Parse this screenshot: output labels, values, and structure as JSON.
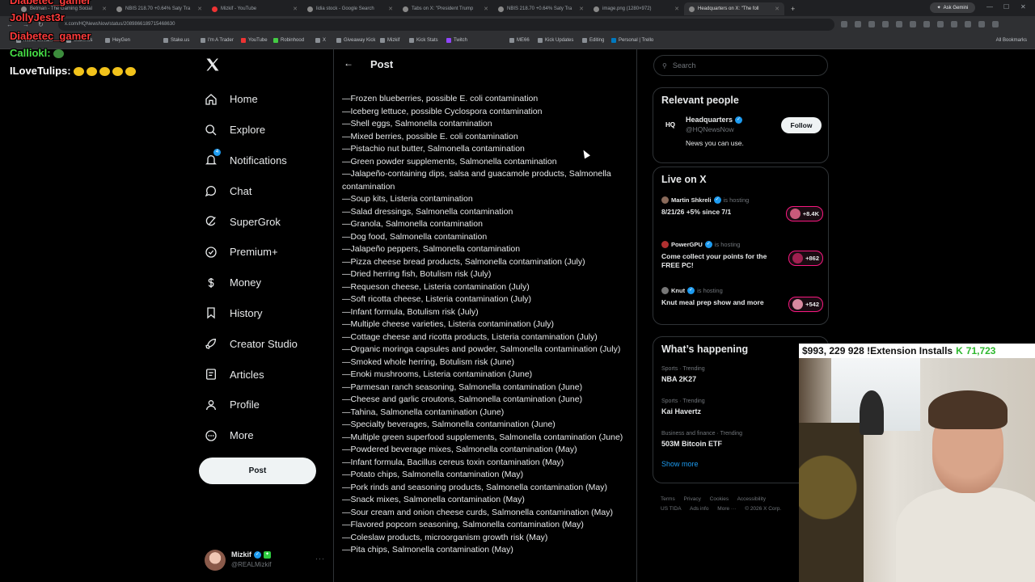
{
  "browser": {
    "tabs": [
      {
        "label": "Betman - The Gaming Social"
      },
      {
        "label": "NBIS 218.70 +0.64% Saty Tra"
      },
      {
        "label": "Mizkif - YouTube"
      },
      {
        "label": "lidia stock - Google Search"
      },
      {
        "label": "Tabs on X: \"President Trump"
      },
      {
        "label": "NBIS 218.70 +0.64% Saty Tra"
      },
      {
        "label": "image.png (1280×972)"
      },
      {
        "label": "Headquarters on X: \"The foll"
      }
    ],
    "address": "x.com/HQNewsNow/status/2089866189715468630",
    "gemini_label": "Ask Gemini",
    "bookmarks": [
      "Mizkif Stream",
      "Stake.us",
      "HeyGen",
      "Stake.us",
      "I'm A Trader",
      "YouTube",
      "Robinhood",
      "X",
      "Giveaway Kick",
      "Mizkif",
      "Kick Stats",
      "Twitch",
      "ME66",
      "Kick Updates",
      "Editing",
      "Personal | Trello"
    ],
    "all_bookmarks": "All Bookmarks"
  },
  "sidebar": {
    "items": [
      {
        "label": "Home",
        "icon": "home-icon"
      },
      {
        "label": "Explore",
        "icon": "search-icon"
      },
      {
        "label": "Notifications",
        "icon": "bell-icon",
        "badge": "4"
      },
      {
        "label": "Chat",
        "icon": "chat-icon"
      },
      {
        "label": "SuperGrok",
        "icon": "grok-icon"
      },
      {
        "label": "Premium+",
        "icon": "premium-icon"
      },
      {
        "label": "Money",
        "icon": "money-icon"
      },
      {
        "label": "History",
        "icon": "bookmark-icon"
      },
      {
        "label": "Creator Studio",
        "icon": "rocket-icon"
      },
      {
        "label": "Articles",
        "icon": "article-icon"
      },
      {
        "label": "Profile",
        "icon": "person-icon"
      },
      {
        "label": "More",
        "icon": "more-icon"
      }
    ],
    "post_label": "Post",
    "account": {
      "name": "Mizkif",
      "handle": "@REALMizkif"
    }
  },
  "post": {
    "header_title": "Post",
    "recalls": [
      "—Frozen blueberries, possible E. coli contamination",
      "—Iceberg lettuce, possible Cyclospora contamination",
      "—Shell eggs, Salmonella contamination",
      "—Mixed berries, possible E. coli contamination",
      "—Pistachio nut butter, Salmonella contamination",
      "—Green powder supplements, Salmonella contamination",
      "—Jalapeño-containing dips, salsa and guacamole products, Salmonella contamination",
      "—Soup kits, Listeria contamination",
      "—Salad dressings, Salmonella contamination",
      "—Granola, Salmonella contamination",
      "—Dog food, Salmonella contamination",
      "—Jalapeño peppers, Salmonella contamination",
      "—Pizza cheese bread products, Salmonella contamination (July)",
      "—Dried herring fish, Botulism risk (July)",
      "—Requeson cheese, Listeria contamination (July)",
      "—Soft ricotta cheese, Listeria contamination (July)",
      "—Infant formula, Botulism risk (July)",
      "—Multiple cheese varieties, Listeria contamination (July)",
      "—Cottage cheese and ricotta products, Listeria contamination (July)",
      "—Organic moringa capsules and powder, Salmonella contamination (July)",
      "—Smoked whole herring, Botulism risk (June)",
      "—Enoki mushrooms, Listeria contamination (June)",
      "—Parmesan ranch seasoning, Salmonella contamination (June)",
      "—Cheese and garlic croutons, Salmonella contamination (June)",
      "—Tahina, Salmonella contamination (June)",
      "—Specialty beverages, Salmonella contamination (June)",
      "—Multiple green superfood supplements, Salmonella contamination (June)",
      "—Powdered beverage mixes, Salmonella contamination (May)",
      "—Infant formula, Bacillus cereus toxin contamination (May)",
      "—Potato chips, Salmonella contamination (May)",
      "—Pork rinds and seasoning products, Salmonella contamination (May)",
      "—Snack mixes, Salmonella contamination (May)",
      "—Sour cream and onion cheese curds, Salmonella contamination (May)",
      "—Flavored popcorn seasoning, Salmonella contamination (May)",
      "—Coleslaw products, microorganism growth risk (May)",
      "—Pita chips, Salmonella contamination (May)"
    ]
  },
  "right": {
    "search_placeholder": "Search",
    "relevant": {
      "title": "Relevant people",
      "name": "Headquarters",
      "handle": "@HQNewsNow",
      "bio": "News you can use.",
      "avatar_text": "HQ",
      "follow_label": "Follow"
    },
    "live": {
      "title": "Live on X",
      "hosting_label": "is hosting",
      "items": [
        {
          "host": "Martin Shkreli",
          "title": "8/21/26 +5% since 7/1",
          "count": "+8.4K"
        },
        {
          "host": "PowerGPU",
          "title": "Come collect your points for the FREE PC!",
          "count": "+862"
        },
        {
          "host": "Knut",
          "title": "Knut meal prep show and more",
          "count": "+542"
        }
      ]
    },
    "happening": {
      "title": "What’s happening",
      "trends": [
        {
          "category": "Sports · Trending",
          "name": "NBA 2K27"
        },
        {
          "category": "Sports · Trending",
          "name": "Kai Havertz"
        },
        {
          "category": "Business and finance · Trending",
          "name": "503M Bitcoin ETF"
        }
      ],
      "show_more": "Show more"
    },
    "footer": [
      "Terms",
      "Privacy",
      "Cookies",
      "Accessibility",
      "US TIDA",
      "Ads info",
      "More ···",
      "© 2026 X Corp."
    ]
  },
  "overlay": {
    "chat": [
      {
        "user": "Diabetec_gamer",
        "color": "#ff3b3b"
      },
      {
        "user": "JollyJest3r",
        "color": "#ff3b3b"
      },
      {
        "user": "Diabetec_gamer",
        "color": "#ff3b3b"
      },
      {
        "user": "Calliokl:",
        "color": "#46e046"
      },
      {
        "user": "ILoveTulips:",
        "color": "#ffffff"
      }
    ],
    "ticker_text": "$993, 229  928 !Extension Installs",
    "ticker_value": "71,723"
  }
}
